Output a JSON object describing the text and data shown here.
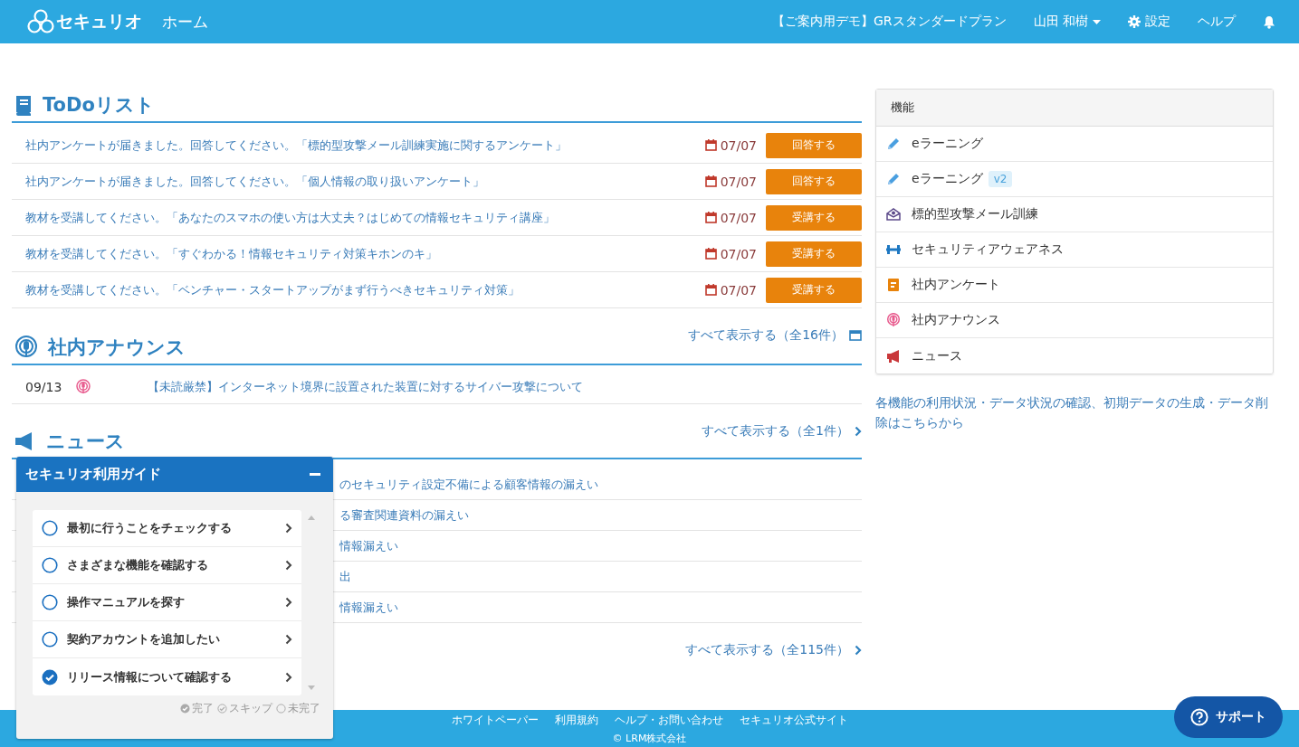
{
  "header": {
    "logo_text": "セキュリオ",
    "page_title": "ホーム",
    "plan": "【ご案内用デモ】GRスタンダードプラン",
    "user": "山田 和樹",
    "settings": "設定",
    "help": "ヘルプ"
  },
  "todo": {
    "title": "ToDoリスト",
    "items": [
      {
        "text": "社内アンケートが届きました。回答してください。「標的型攻撃メール訓練実施に関するアンケート」",
        "date": "07/07",
        "action": "回答する"
      },
      {
        "text": "社内アンケートが届きました。回答してください。「個人情報の取り扱いアンケート」",
        "date": "07/07",
        "action": "回答する"
      },
      {
        "text": "教材を受講してください。「あなたのスマホの使い方は大丈夫？はじめての情報セキュリティ講座」",
        "date": "07/07",
        "action": "受講する"
      },
      {
        "text": "教材を受講してください。「すぐわかる！情報セキュリティ対策キホンのキ」",
        "date": "07/07",
        "action": "受講する"
      },
      {
        "text": "教材を受講してください。「ベンチャー・スタートアップがまず行うべきセキュリティ対策」",
        "date": "07/07",
        "action": "受講する"
      }
    ],
    "show_all": "すべて表示する（全16件）"
  },
  "announcements": {
    "title": "社内アナウンス",
    "items": [
      {
        "date": "09/13",
        "text": "【未読厳禁】インターネット境界に設置された装置に対するサイバー攻撃について"
      }
    ],
    "show_all": "すべて表示する（全1件）"
  },
  "news": {
    "title": "ニュース",
    "items": [
      {
        "text": "のセキュリティ設定不備による顧客情報の漏えい"
      },
      {
        "text": "る審査関連資料の漏えい"
      },
      {
        "text": "情報漏えい"
      },
      {
        "text": "出"
      },
      {
        "text": "情報漏えい"
      }
    ],
    "show_all": "すべて表示する（全115件）"
  },
  "features": {
    "title": "機能",
    "items": [
      {
        "kind": "elearning",
        "label": "eラーニング"
      },
      {
        "kind": "elearning",
        "label": "eラーニング",
        "badge": "v2"
      },
      {
        "kind": "phishing",
        "label": "標的型攻撃メール訓練"
      },
      {
        "kind": "awareness",
        "label": "セキュリティアウェアネス"
      },
      {
        "kind": "survey",
        "label": "社内アンケート"
      },
      {
        "kind": "announce",
        "label": "社内アナウンス"
      },
      {
        "kind": "news",
        "label": "ニュース"
      }
    ],
    "note": "各機能の利用状況・データ状況の確認、初期データの生成・データ削除はこちらから"
  },
  "guide": {
    "title": "セキュリオ利用ガイド",
    "items": [
      {
        "label": "最初に行うことをチェックする",
        "checked": false
      },
      {
        "label": "さまざまな機能を確認する",
        "checked": false
      },
      {
        "label": "操作マニュアルを探す",
        "checked": false
      },
      {
        "label": "契約アカウントを追加したい",
        "checked": false
      },
      {
        "label": "リリース情報について確認する",
        "checked": true
      }
    ],
    "legend": [
      {
        "kind": "done",
        "label": "完了"
      },
      {
        "kind": "skip",
        "label": "スキップ"
      },
      {
        "kind": "todo",
        "label": "未完了"
      }
    ]
  },
  "footer": {
    "links": [
      "ホワイトペーパー",
      "利用規約",
      "ヘルプ・お問い合わせ",
      "セキュリオ公式サイト"
    ],
    "copyright": "© LRM株式会社"
  },
  "support": "サポート"
}
